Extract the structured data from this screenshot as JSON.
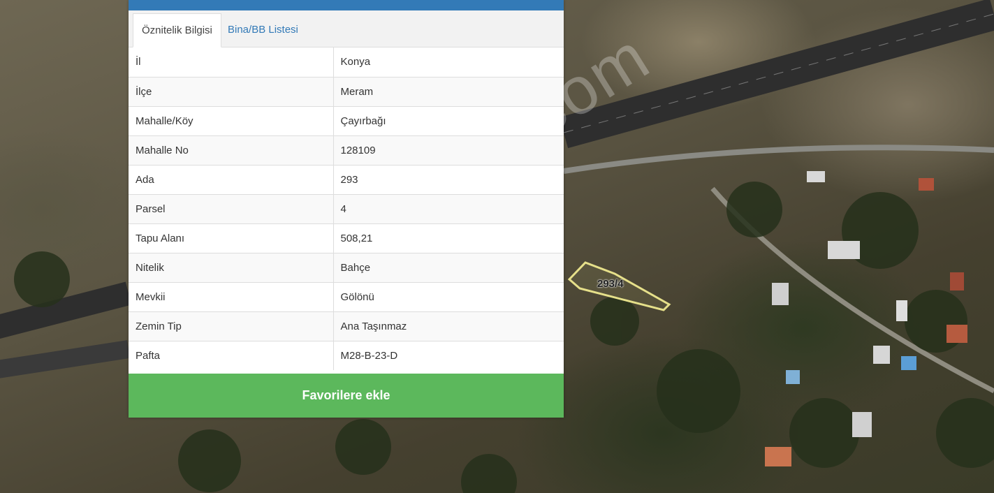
{
  "tabs": {
    "attribute_info": "Öznitelik Bilgisi",
    "building_list": "Bina/BB Listesi"
  },
  "attributes": [
    {
      "key": "İl",
      "value": "Konya"
    },
    {
      "key": "İlçe",
      "value": "Meram"
    },
    {
      "key": "Mahalle/Köy",
      "value": "Çayırbağı"
    },
    {
      "key": "Mahalle No",
      "value": "128109"
    },
    {
      "key": "Ada",
      "value": "293"
    },
    {
      "key": "Parsel",
      "value": "4"
    },
    {
      "key": "Tapu Alanı",
      "value": "508,21"
    },
    {
      "key": "Nitelik",
      "value": "Bahçe"
    },
    {
      "key": "Mevkii",
      "value": "Gölönü"
    },
    {
      "key": "Zemin Tip",
      "value": "Ana Taşınmaz"
    },
    {
      "key": "Pafta",
      "value": "M28-B-23-D"
    }
  ],
  "favorite_button": "Favorilere ekle",
  "map": {
    "parcel_label": "293/4",
    "watermark": "emlakjet.com"
  },
  "colors": {
    "header_bar": "#337ab7",
    "tab_link": "#337ab7",
    "favorite_button": "#5cb85c",
    "parcel_outline": "#e6e08a"
  }
}
